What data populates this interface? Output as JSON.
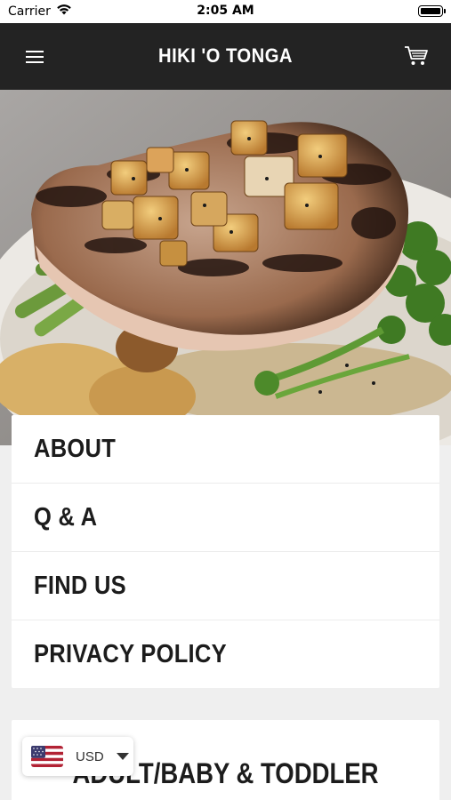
{
  "status_bar": {
    "carrier": "Carrier",
    "time": "2:05 AM"
  },
  "header": {
    "title": "HIKI 'O TONGA",
    "menu_icon": "hamburger-menu-icon",
    "cart_icon": "shopping-cart-icon"
  },
  "menu": {
    "items": [
      {
        "label": "ABOUT"
      },
      {
        "label": "Q & A"
      },
      {
        "label": "FIND US"
      },
      {
        "label": "PRIVACY POLICY"
      }
    ]
  },
  "collection": {
    "title": "ADULT/BABY & TODDLER"
  },
  "currency": {
    "code": "USD",
    "flag_icon": "us-flag-icon",
    "dropdown_icon": "caret-down-icon"
  },
  "colors": {
    "header_bg": "#232323",
    "page_bg": "#efefef",
    "card_bg": "#ffffff",
    "text_dark": "#1c1c1c"
  }
}
